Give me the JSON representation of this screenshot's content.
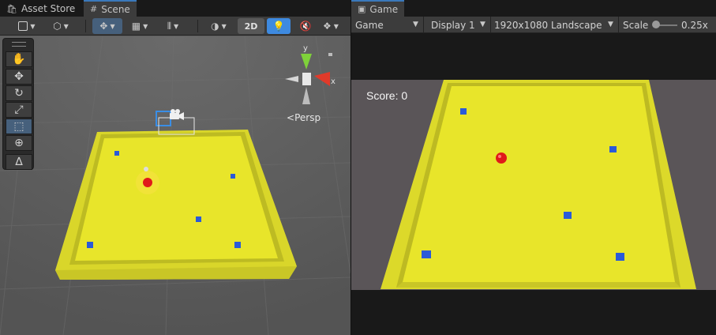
{
  "tabs": {
    "asset_store": "Asset Store",
    "scene": "Scene",
    "game": "Game"
  },
  "scene_toolbar": {
    "mode_2d": "2D",
    "active_tool": "rect-transform",
    "view_label": "Persp",
    "gizmo_axes": {
      "y": "y",
      "x": "x"
    }
  },
  "tool_palette": [
    "hand",
    "move",
    "rotate",
    "scale",
    "rect",
    "transform",
    "custom"
  ],
  "game_toolbar": {
    "display_mode": "Game",
    "display": "Display 1",
    "resolution": "1920x1080 Landscape",
    "scale_label": "Scale",
    "scale_value": "0.25x",
    "scale_level": 0.0
  },
  "game": {
    "score_text": "Score: 0"
  },
  "colors": {
    "platform": "#e8e52a",
    "pickup": "#2a5ad8",
    "player": "#e01a1a",
    "accent": "#3a79bb"
  }
}
